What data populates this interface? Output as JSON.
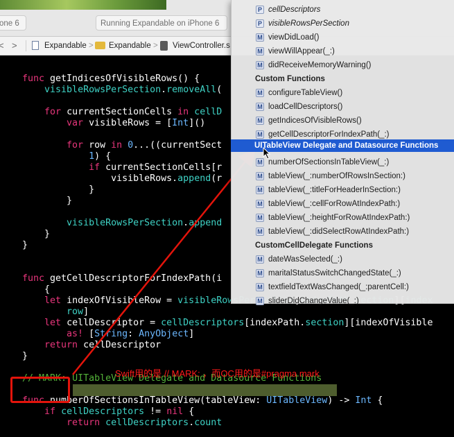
{
  "toolbar": {
    "scheme_tab": "one 6",
    "status_tab": "Running Expandable on iPhone 6"
  },
  "pathbar": {
    "back": "<",
    "forward": ">",
    "crumb_chevron": ">",
    "crumbs": [
      "Expandable",
      "Expandable",
      "ViewController.s"
    ]
  },
  "code": [
    [
      {
        "t": "func ",
        "c": "kw"
      },
      {
        "t": "getIndicesOfVisibleRows() {",
        "c": ""
      }
    ],
    [
      {
        "t": "    ",
        "c": ""
      },
      {
        "t": "visibleRowsPerSection",
        "c": "fn"
      },
      {
        "t": ".",
        "c": ""
      },
      {
        "t": "removeAll",
        "c": "fn"
      },
      {
        "t": "(",
        "c": ""
      }
    ],
    [],
    [
      {
        "t": "    ",
        "c": ""
      },
      {
        "t": "for ",
        "c": "kw"
      },
      {
        "t": "currentSectionCells ",
        "c": ""
      },
      {
        "t": "in ",
        "c": "kw"
      },
      {
        "t": "cellD",
        "c": "fn"
      }
    ],
    [
      {
        "t": "        ",
        "c": ""
      },
      {
        "t": "var ",
        "c": "kw"
      },
      {
        "t": "visibleRows = [",
        "c": ""
      },
      {
        "t": "Int",
        "c": "ty"
      },
      {
        "t": "]()",
        "c": ""
      }
    ],
    [],
    [
      {
        "t": "        ",
        "c": ""
      },
      {
        "t": "for ",
        "c": "kw"
      },
      {
        "t": "row ",
        "c": ""
      },
      {
        "t": "in ",
        "c": "kw"
      },
      {
        "t": "0",
        "c": "ty"
      },
      {
        "t": "...((currentSect",
        "c": ""
      }
    ],
    [
      {
        "t": "            ",
        "c": ""
      },
      {
        "t": "1",
        "c": "ty"
      },
      {
        "t": ") {",
        "c": ""
      }
    ],
    [
      {
        "t": "            ",
        "c": ""
      },
      {
        "t": "if ",
        "c": "kw"
      },
      {
        "t": "currentSectionCells[r",
        "c": ""
      }
    ],
    [
      {
        "t": "                ",
        "c": ""
      },
      {
        "t": "visibleRows.",
        "c": ""
      },
      {
        "t": "append",
        "c": "fn"
      },
      {
        "t": "(r",
        "c": ""
      }
    ],
    [
      {
        "t": "            }",
        "c": ""
      }
    ],
    [
      {
        "t": "        }",
        "c": ""
      }
    ],
    [],
    [
      {
        "t": "        ",
        "c": ""
      },
      {
        "t": "visibleRowsPerSection",
        "c": "fn"
      },
      {
        "t": ".",
        "c": ""
      },
      {
        "t": "append",
        "c": "fn"
      }
    ],
    [
      {
        "t": "    }",
        "c": ""
      }
    ],
    [
      {
        "t": "}",
        "c": ""
      }
    ],
    [],
    [],
    [
      {
        "t": "func ",
        "c": "kw"
      },
      {
        "t": "getCellDescriptorForIndexPath(i",
        "c": ""
      }
    ],
    [
      {
        "t": "    {",
        "c": ""
      }
    ],
    [
      {
        "t": "    ",
        "c": ""
      },
      {
        "t": "let ",
        "c": "kw"
      },
      {
        "t": "indexOfVisibleRow = ",
        "c": ""
      },
      {
        "t": "visibleRowsPerSection",
        "c": "fn"
      },
      {
        "t": "[",
        "c": ""
      },
      {
        "t": "indexPath",
        "c": "fn"
      },
      {
        "t": ".",
        "c": ""
      },
      {
        "t": "section",
        "c": "fn"
      },
      {
        "t": "][",
        "c": ""
      },
      {
        "t": "index",
        "c": "fn"
      }
    ],
    [
      {
        "t": "        ",
        "c": ""
      },
      {
        "t": "row",
        "c": "fn"
      },
      {
        "t": "]",
        "c": ""
      }
    ],
    [
      {
        "t": "    ",
        "c": ""
      },
      {
        "t": "let ",
        "c": "kw"
      },
      {
        "t": "cellDescriptor = ",
        "c": ""
      },
      {
        "t": "cellDescriptors",
        "c": "fn"
      },
      {
        "t": "[indexPath.",
        "c": ""
      },
      {
        "t": "section",
        "c": "fn"
      },
      {
        "t": "][indexOfVisible",
        "c": ""
      }
    ],
    [
      {
        "t": "        ",
        "c": ""
      },
      {
        "t": "as! ",
        "c": "kw"
      },
      {
        "t": "[",
        "c": ""
      },
      {
        "t": "String",
        "c": "ty"
      },
      {
        "t": ": ",
        "c": ""
      },
      {
        "t": "AnyObject",
        "c": "ty"
      },
      {
        "t": "]",
        "c": ""
      }
    ],
    [
      {
        "t": "    ",
        "c": ""
      },
      {
        "t": "return ",
        "c": "kw"
      },
      {
        "t": "cellDescriptor",
        "c": ""
      }
    ],
    [
      {
        "t": "}",
        "c": ""
      }
    ],
    [],
    [
      {
        "t": "// MARK: ",
        "c": "mk"
      },
      {
        "t": "UITableView Delegate and Datasource Functions",
        "c": "mk"
      }
    ],
    [],
    [
      {
        "t": "func ",
        "c": "kw"
      },
      {
        "t": "numberOfSectionsInTableView(tableView: ",
        "c": ""
      },
      {
        "t": "UITableView",
        "c": "ty"
      },
      {
        "t": ") -> ",
        "c": ""
      },
      {
        "t": "Int",
        "c": "ty"
      },
      {
        "t": " {",
        "c": ""
      }
    ],
    [
      {
        "t": "    ",
        "c": ""
      },
      {
        "t": "if ",
        "c": "kw"
      },
      {
        "t": "cellDescriptors ",
        "c": "fn"
      },
      {
        "t": "!= ",
        "c": ""
      },
      {
        "t": "nil",
        "c": "kw"
      },
      {
        "t": " {",
        "c": ""
      }
    ],
    [
      {
        "t": "        ",
        "c": ""
      },
      {
        "t": "return ",
        "c": "kw"
      },
      {
        "t": "cellDescriptors",
        "c": "fn"
      },
      {
        "t": ".",
        "c": ""
      },
      {
        "t": "count",
        "c": "fn"
      }
    ]
  ],
  "annotation": {
    "text": "Swift用的是 // MARK: ，而OC用的是#pragma mark"
  },
  "popup": {
    "items": [
      {
        "kind": "item",
        "icon": "P",
        "label": "cellDescriptors",
        "italic": true
      },
      {
        "kind": "item",
        "icon": "P",
        "label": "visibleRowsPerSection",
        "italic": true
      },
      {
        "kind": "item",
        "icon": "M",
        "label": "viewDidLoad()"
      },
      {
        "kind": "item",
        "icon": "M",
        "label": "viewWillAppear(_:)"
      },
      {
        "kind": "item",
        "icon": "M",
        "label": "didReceiveMemoryWarning()"
      },
      {
        "kind": "header",
        "label": "Custom Functions"
      },
      {
        "kind": "item",
        "icon": "M",
        "label": "configureTableView()"
      },
      {
        "kind": "item",
        "icon": "M",
        "label": "loadCellDescriptors()"
      },
      {
        "kind": "item",
        "icon": "M",
        "label": "getIndicesOfVisibleRows()"
      },
      {
        "kind": "item",
        "icon": "M",
        "label": "getCellDescriptorForIndexPath(_:)"
      },
      {
        "kind": "selected",
        "label": "UITableView Delegate and Datasource Functions"
      },
      {
        "kind": "item",
        "icon": "M",
        "label": "numberOfSectionsInTableView(_:)"
      },
      {
        "kind": "item",
        "icon": "M",
        "label": "tableView(_:numberOfRowsInSection:)"
      },
      {
        "kind": "item",
        "icon": "M",
        "label": "tableView(_:titleForHeaderInSection:)"
      },
      {
        "kind": "item",
        "icon": "M",
        "label": "tableView(_:cellForRowAtIndexPath:)"
      },
      {
        "kind": "item",
        "icon": "M",
        "label": "tableView(_:heightForRowAtIndexPath:)"
      },
      {
        "kind": "item",
        "icon": "M",
        "label": "tableView(_:didSelectRowAtIndexPath:)"
      },
      {
        "kind": "header",
        "label": "CustomCellDelegate Functions"
      },
      {
        "kind": "item",
        "icon": "M",
        "label": "dateWasSelected(_:)"
      },
      {
        "kind": "item",
        "icon": "M",
        "label": "maritalStatusSwitchChangedState(_:)"
      },
      {
        "kind": "item",
        "icon": "M",
        "label": "textfieldTextWasChanged(_:parentCell:)"
      },
      {
        "kind": "item",
        "icon": "M",
        "label": "sliderDidChangeValue(_:)"
      }
    ]
  },
  "colors": {
    "keyword": "#e9367c",
    "type": "#6cb8ff",
    "function": "#3fd3c6",
    "mark_comment": "#54b339",
    "selection": "#1f5bd1",
    "annotation": "#e3140b"
  }
}
